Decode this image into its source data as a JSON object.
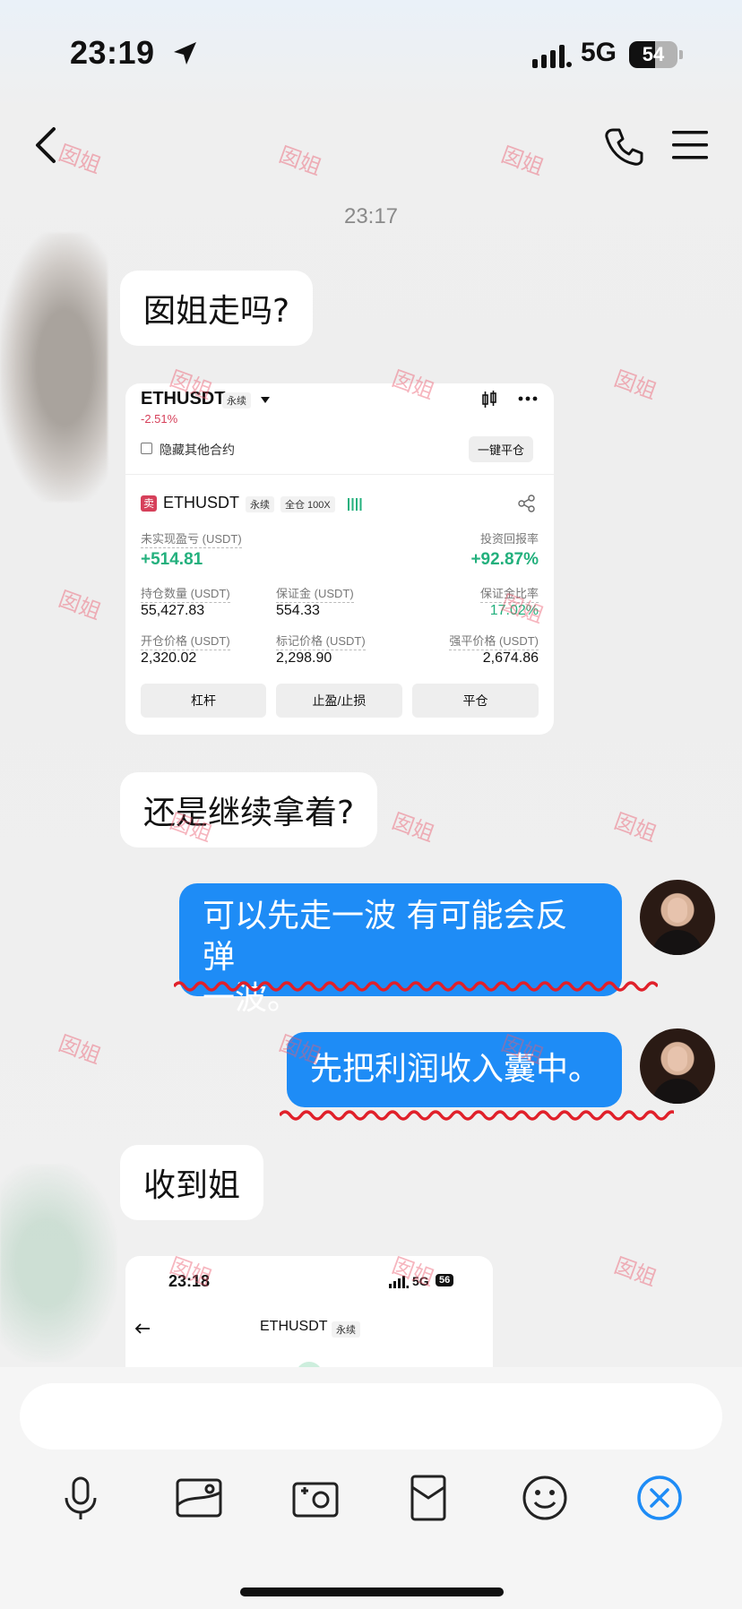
{
  "status_bar": {
    "time": "23:19",
    "network": "5G",
    "battery": "54",
    "battery_level": 0.54
  },
  "nav": {
    "back_icon": "chevron-left-icon",
    "phone_icon": "phone-icon",
    "menu_icon": "hamburger-menu-icon"
  },
  "chat": {
    "timestamp": "23:17",
    "messages": [
      {
        "side": "left",
        "type": "text",
        "text": "囡姐走吗?"
      },
      {
        "side": "left",
        "type": "image",
        "card": "trade_card"
      },
      {
        "side": "left",
        "type": "text",
        "text": "还是继续拿着?"
      },
      {
        "side": "right",
        "type": "text",
        "lines": [
          "可以先走一波 有可能会反弹",
          "一波。"
        ]
      },
      {
        "side": "right",
        "type": "text",
        "text": "先把利润收入囊中。"
      },
      {
        "side": "left",
        "type": "text",
        "text": "收到姐"
      },
      {
        "side": "left",
        "type": "image",
        "card": "shot_card"
      }
    ]
  },
  "trade_card": {
    "symbol": "ETHUSDT",
    "perp_tag": "永续",
    "change": "-2.51%",
    "hide_label": "隐藏其他合约",
    "close_all": "一键平仓",
    "side_badge": "卖",
    "position_symbol": "ETHUSDT",
    "position_perp": "永续",
    "margin_mode": "全仓 100X",
    "unrealized_label": "未实现盈亏 (USDT)",
    "unrealized_value": "+514.81",
    "roi_label": "投资回报率",
    "roi_value": "+92.87%",
    "qty_label": "持仓数量 (USDT)",
    "qty_value": "55,427.83",
    "margin_label": "保证金 (USDT)",
    "margin_value": "554.33",
    "margin_ratio_label": "保证金比率",
    "margin_ratio_value": "17.02%",
    "entry_label": "开仓价格 (USDT)",
    "entry_value": "2,320.02",
    "mark_label": "标记价格 (USDT)",
    "mark_value": "2,298.90",
    "liq_label": "强平价格 (USDT)",
    "liq_value": "2,674.86",
    "btn_leverage": "杠杆",
    "btn_tpsl": "止盈/止损",
    "btn_close": "平仓",
    "accent_green": "#23b07d",
    "accent_red": "#d6405a"
  },
  "shot_card": {
    "time": "23:18",
    "network": "5G",
    "battery": "56",
    "title": "ETHUSDT",
    "title_tag": "永续"
  },
  "input": {
    "placeholder": "",
    "tools": [
      "microphone-icon",
      "image-icon",
      "camera-icon",
      "red-packet-icon",
      "emoji-icon",
      "close-icon"
    ]
  },
  "watermark": "囡姐",
  "colors": {
    "bubble_right": "#1e8cf6",
    "bubble_left": "#ffffff",
    "close_icon": "#1e8cf6",
    "squiggle": "#e0202a"
  }
}
